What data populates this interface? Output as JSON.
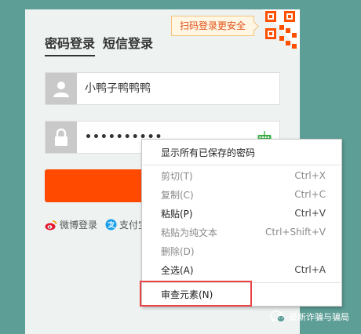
{
  "login": {
    "qr_tip": "扫码登录更安全",
    "tabs": [
      {
        "label": "密码登录",
        "active": true
      },
      {
        "label": "短信登录",
        "active": false
      }
    ],
    "username_value": "小鸭子鸭鸭鸭",
    "password_value": "••••••••••",
    "social": [
      {
        "label": "微博登录",
        "icon": "weibo-icon"
      },
      {
        "label": "支付宝",
        "icon": "alipay-icon"
      }
    ]
  },
  "context_menu": {
    "items": [
      {
        "label": "显示所有已保存的密码",
        "shortcut": "",
        "enabled": true
      },
      {
        "label": "剪切(T)",
        "shortcut": "Ctrl+X",
        "enabled": false
      },
      {
        "label": "复制(C)",
        "shortcut": "Ctrl+C",
        "enabled": false
      },
      {
        "label": "粘贴(P)",
        "shortcut": "Ctrl+V",
        "enabled": true
      },
      {
        "label": "粘贴为纯文本",
        "shortcut": "Ctrl+Shift+V",
        "enabled": false
      },
      {
        "label": "删除(D)",
        "shortcut": "",
        "enabled": false
      },
      {
        "label": "全选(A)",
        "shortcut": "Ctrl+A",
        "enabled": true
      },
      {
        "label": "审查元素(N)",
        "shortcut": "",
        "enabled": true
      }
    ]
  },
  "watermark": {
    "text": "最新诈骗与骗局",
    "icon": "wechat-icon"
  },
  "colors": {
    "accent": "#ff4a00",
    "background": "#5d9e96",
    "highlight": "#e94343"
  }
}
